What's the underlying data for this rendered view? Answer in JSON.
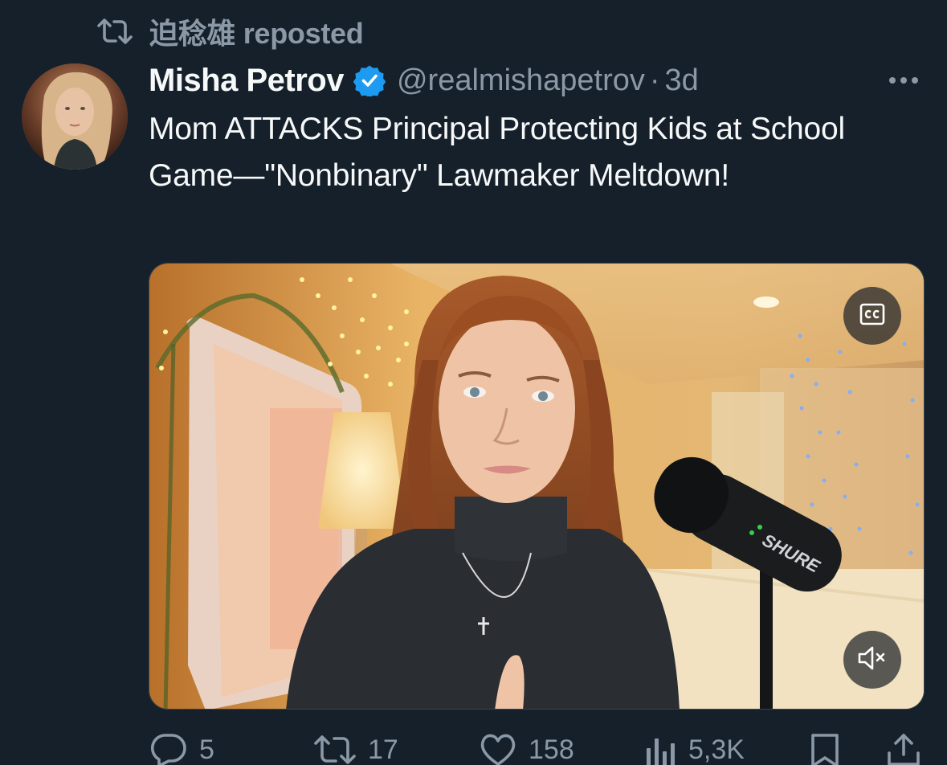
{
  "repost": {
    "icon": "repost-icon",
    "label": "迫稔雄 reposted"
  },
  "author": {
    "display_name": "Misha Petrov",
    "verified": true,
    "handle": "@realmishapetrov",
    "separator": "·",
    "time": "3d"
  },
  "tweet": {
    "text": "Mom ATTACKS Principal Protecting Kids at School Game—\"Nonbinary\" Lawmaker Meltdown!"
  },
  "media": {
    "type": "video",
    "mic_brand": "SHURE",
    "captions_icon": "closed-captions-icon",
    "mute_icon": "speaker-muted-icon"
  },
  "actions": {
    "replies": "5",
    "reposts": "17",
    "likes": "158",
    "views": "5,3K"
  },
  "colors": {
    "background": "#15202b",
    "text_primary": "#f7f9f9",
    "text_secondary": "#8b98a5",
    "verified_blue": "#1d9bf0"
  }
}
